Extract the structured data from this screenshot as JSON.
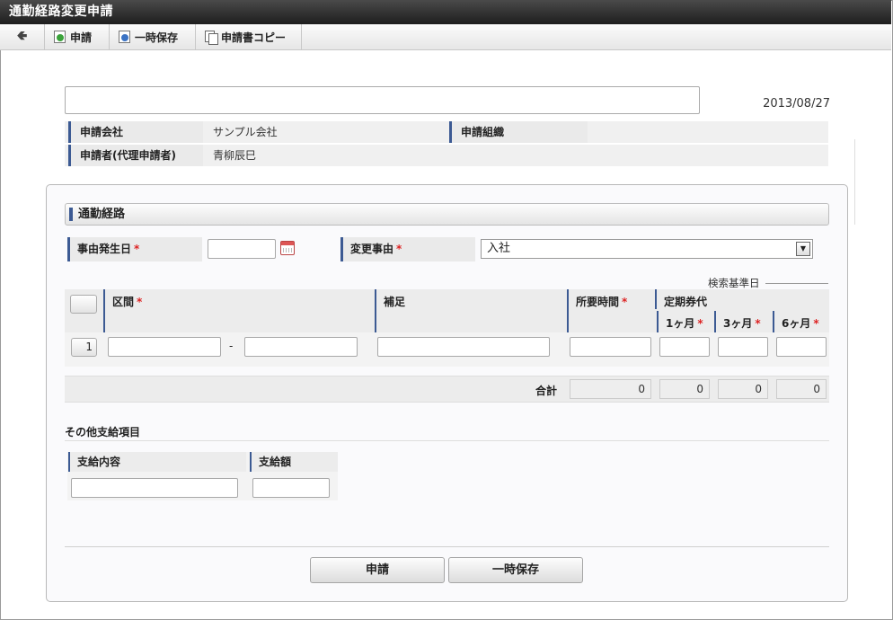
{
  "window": {
    "title": "通勤経路変更申請"
  },
  "toolbar": {
    "apply_label": "申請",
    "save_label": "一時保存",
    "copy_label": "申請書コピー"
  },
  "header": {
    "title_value": "",
    "date": "2013/08/27",
    "company_label": "申請会社",
    "company_value": "サンプル会社",
    "org_label": "申請組織",
    "org_value": "",
    "applicant_label": "申請者(代理申請者)",
    "applicant_value": "青柳辰巳"
  },
  "route": {
    "section_title": "通勤経路",
    "event_date_label": "事由発生日",
    "event_date_value": "",
    "reason_label": "変更事由",
    "reason_value": "入社",
    "required_mark": "*",
    "search_date_label": "検索基準日",
    "columns": {
      "section": "区間",
      "note": "補足",
      "time": "所要時間",
      "pass": "定期券代",
      "m1": "1ヶ月",
      "m3": "3ヶ月",
      "m6": "6ヶ月"
    },
    "rows": [
      {
        "no": "1",
        "from": "",
        "to": "",
        "dash": "-",
        "note": "",
        "time": "",
        "m1": "",
        "m3": "",
        "m6": ""
      }
    ],
    "total_label": "合計",
    "totals": {
      "time": "0",
      "m1": "0",
      "m3": "0",
      "m6": "0"
    }
  },
  "other": {
    "title": "その他支給項目",
    "content_label": "支給内容",
    "amount_label": "支給額",
    "content_value": "",
    "amount_value": ""
  },
  "footer": {
    "apply_label": "申請",
    "save_label": "一時保存"
  }
}
